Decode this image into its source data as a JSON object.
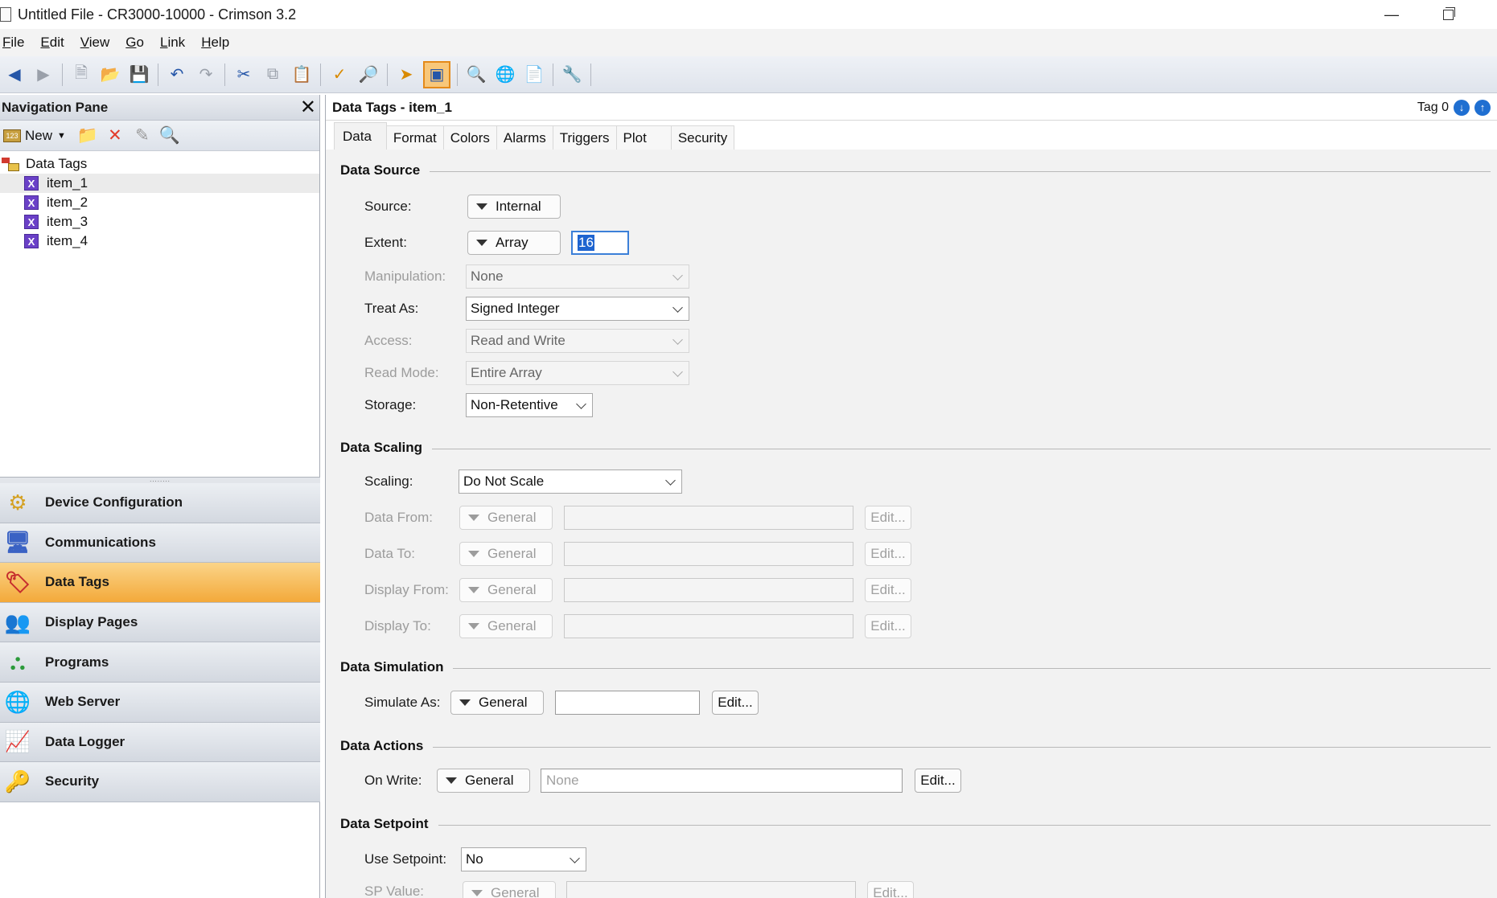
{
  "window": {
    "title": "Untitled File - CR3000-10000 - Crimson 3.2",
    "minimize": "—",
    "restore": ""
  },
  "menu": [
    {
      "key": "F",
      "rest": "ile"
    },
    {
      "key": "E",
      "rest": "dit"
    },
    {
      "key": "V",
      "rest": "iew"
    },
    {
      "key": "G",
      "rest": "o"
    },
    {
      "key": "L",
      "rest": "ink"
    },
    {
      "key": "H",
      "rest": "elp"
    }
  ],
  "nav": {
    "title": "Navigation Pane",
    "close": "✕",
    "new_label": "New",
    "root": "Data Tags",
    "items": [
      "item_1",
      "item_2",
      "item_3",
      "item_4"
    ],
    "grip": "........",
    "categories": [
      {
        "label": "Device Configuration",
        "icon": "⚙"
      },
      {
        "label": "Communications",
        "icon": "🖥"
      },
      {
        "label": "Data Tags",
        "icon": "🏷"
      },
      {
        "label": "Display Pages",
        "icon": "👥"
      },
      {
        "label": "Programs",
        "icon": "⛬"
      },
      {
        "label": "Web Server",
        "icon": "🌐"
      },
      {
        "label": "Data Logger",
        "icon": "📈"
      },
      {
        "label": "Security",
        "icon": "🔑"
      }
    ]
  },
  "main": {
    "title": "Data Tags - item_1",
    "tag_label": "Tag 0",
    "tabs": [
      "Data",
      "Format",
      "Colors",
      "Alarms",
      "Triggers",
      "Plot",
      "Security"
    ],
    "sections": {
      "source": "Data Source",
      "scaling": "Data Scaling",
      "simulation": "Data Simulation",
      "actions": "Data Actions",
      "setpoint": "Data Setpoint"
    },
    "fields": {
      "source_label": "Source:",
      "source_value": "Internal",
      "extent_label": "Extent:",
      "extent_value": "Array",
      "extent_count": "16",
      "manip_label": "Manipulation:",
      "manip_value": "None",
      "treat_label": "Treat As:",
      "treat_value": "Signed Integer",
      "access_label": "Access:",
      "access_value": "Read and Write",
      "readmode_label": "Read Mode:",
      "readmode_value": "Entire Array",
      "storage_label": "Storage:",
      "storage_value": "Non-Retentive",
      "scaling_label": "Scaling:",
      "scaling_value": "Do Not Scale",
      "datafrom_label": "Data From:",
      "datato_label": "Data To:",
      "dispfrom_label": "Display From:",
      "dispto_label": "Display To:",
      "general": "General",
      "edit": "Edit...",
      "simulate_label": "Simulate As:",
      "onwrite_label": "On Write:",
      "onwrite_placeholder": "None",
      "usesp_label": "Use Setpoint:",
      "usesp_value": "No",
      "spvalue_label": "SP Value:"
    }
  }
}
